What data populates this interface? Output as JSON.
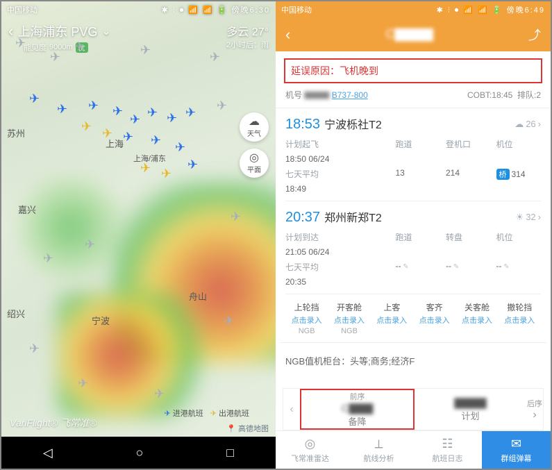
{
  "left": {
    "status": {
      "carrier": "中国移动",
      "icons": "✱ ⫶ ⏺ 📶 📶 🔋",
      "time": "傍晚6:30"
    },
    "header": {
      "title": "上海浦东 PVG",
      "sub_label": "能见度",
      "sub_val": "9000m",
      "aqi": "优",
      "weather": "多云 27°",
      "forecast": "2小时后：雨"
    },
    "fabs": {
      "wx_icon": "☁",
      "wx_label": "天气",
      "mode_icon": "◎",
      "mode_label": "平面"
    },
    "cities": {
      "suzhou": "苏州",
      "shanghai": "上海",
      "pudong": "上海/浦东",
      "jiaxing": "嘉兴",
      "shaoxing": "绍兴",
      "ningbo": "宁波",
      "zhoushan": "舟山"
    },
    "watermark": "VariFlight® 飞常准®",
    "legend": {
      "in": "进港航班",
      "out": "出港航班"
    },
    "credit": "高德地图",
    "nav": {
      "back": "◁",
      "home": "○",
      "recent": "□"
    }
  },
  "right": {
    "status": {
      "carrier": "中国移动",
      "icons": "✱ ⫶ ⏺ 📶 📶 🔋",
      "time": "傍晚6:49"
    },
    "header": {
      "title": "C▇▇▇▇"
    },
    "delay": {
      "label": "延误原因：",
      "reason": "飞机晚到"
    },
    "meta": {
      "model_label": "机号",
      "model": "B737-800",
      "cobt": "COBT:18:45",
      "queue": "排队:2"
    },
    "dep": {
      "time": "18:53",
      "name": "宁波栎社T2",
      "wx": "☁",
      "temp": "26",
      "rows": {
        "plan_label": "计划起飞",
        "plan": "18:50 06/24",
        "avg_label": "七天平均",
        "avg": "18:49",
        "col1": "跑道",
        "col2": "登机口",
        "col3": "机位",
        "v1": "13",
        "v2": "214",
        "v3_badge": "桥",
        "v3": "314"
      }
    },
    "arr": {
      "time": "20:37",
      "name": "郑州新郑T2",
      "wx": "☀",
      "temp": "32",
      "rows": {
        "plan_label": "计划到达",
        "plan": "21:05 06/24",
        "avg_label": "七天平均",
        "avg": "20:35",
        "col1": "跑道",
        "col2": "转盘",
        "col3": "机位",
        "v1": "--",
        "v2": "--",
        "v3": "--"
      }
    },
    "ops": [
      {
        "t": "上轮挡",
        "a": "点击录入",
        "s": "NGB"
      },
      {
        "t": "开客舱",
        "a": "点击录入",
        "s": "NGB"
      },
      {
        "t": "上客",
        "a": "点击录入",
        "s": ""
      },
      {
        "t": "客齐",
        "a": "点击录入",
        "s": ""
      },
      {
        "t": "关客舱",
        "a": "点击录入",
        "s": ""
      },
      {
        "t": "撤轮挡",
        "a": "点击录入",
        "s": ""
      }
    ],
    "counter": "NGB值机柜台：头等;商务;经济F",
    "sequence": {
      "prev_label": "前序",
      "prev_flight": "C▇▇▇",
      "prev_status": "备降",
      "next_label": "后序",
      "next_flight": "▇▇▇▇",
      "next_status": "计划"
    },
    "tabs": [
      {
        "icon": "◎",
        "label": "飞常准雷达"
      },
      {
        "icon": "⟂",
        "label": "航线分析"
      },
      {
        "icon": "☷",
        "label": "航班日志"
      },
      {
        "icon": "✉",
        "label": "群组弹幕"
      }
    ]
  }
}
